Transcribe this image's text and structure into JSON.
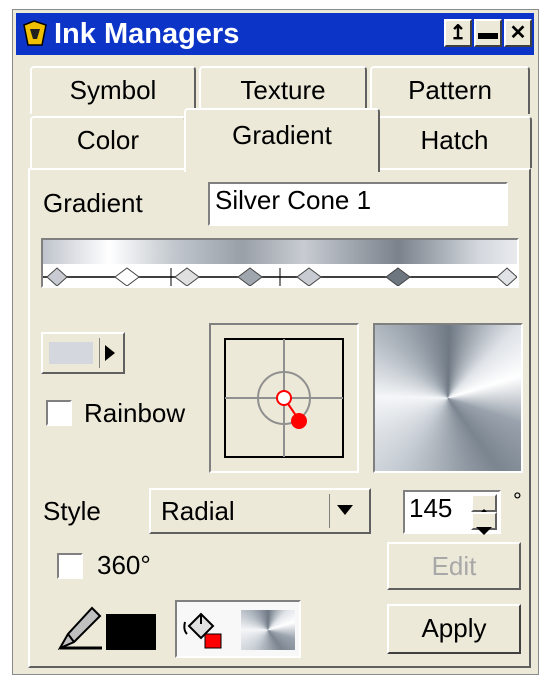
{
  "window": {
    "title": "Ink Managers"
  },
  "titlebar_buttons": {
    "restore": "↥",
    "minimize": "▬",
    "close": "✕"
  },
  "tabs_back": [
    "Symbol",
    "Texture",
    "Pattern"
  ],
  "tabs_front": [
    "Color",
    "Gradient",
    "Hatch"
  ],
  "active_tab": "Gradient",
  "gradient": {
    "label": "Gradient",
    "name": "Silver Cone 1"
  },
  "rainbow": {
    "label": "Rainbow",
    "checked": false
  },
  "style": {
    "label": "Style",
    "value": "Radial"
  },
  "angle": {
    "value": "145",
    "unit": "°"
  },
  "deg360": {
    "label": "360°",
    "checked": false
  },
  "buttons": {
    "edit": "Edit",
    "apply": "Apply"
  },
  "icons": {
    "app": "ink-managers-app-icon",
    "pen": "pen-icon",
    "fill": "paint-bucket-icon"
  },
  "colors": {
    "titlebar": "#0c35c8",
    "face": "#ece9d8",
    "pen_color": "#000000",
    "marker": "#ff0000"
  }
}
